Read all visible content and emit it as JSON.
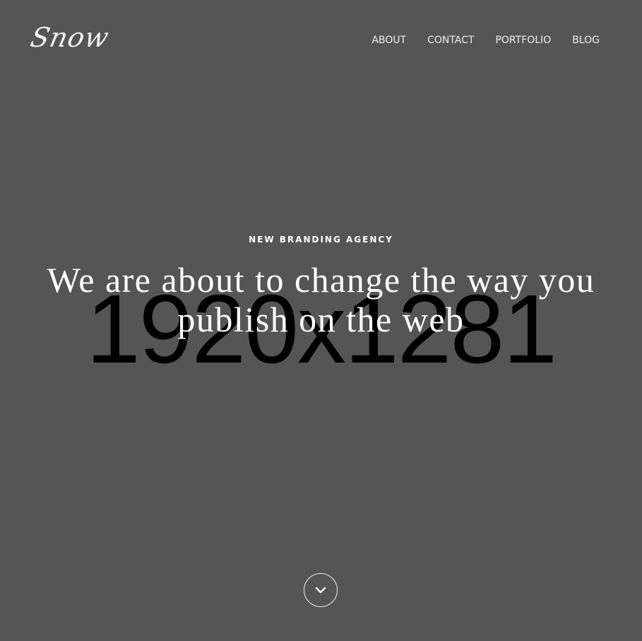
{
  "placeholder": {
    "label": "1920x1281"
  },
  "header": {
    "logo": "Snow",
    "nav": [
      {
        "label": "ABOUT"
      },
      {
        "label": "CONTACT"
      },
      {
        "label": "PORTFOLIO"
      },
      {
        "label": "BLOG"
      }
    ]
  },
  "hero": {
    "eyebrow": "NEW BRANDING AGENCY",
    "headline": "We are about to change the way you publish on the web"
  },
  "scroll": {
    "icon": "chevron-down-icon"
  },
  "colors": {
    "background": "#555555",
    "text": "#ffffff",
    "placeholder_text": "#000000"
  }
}
